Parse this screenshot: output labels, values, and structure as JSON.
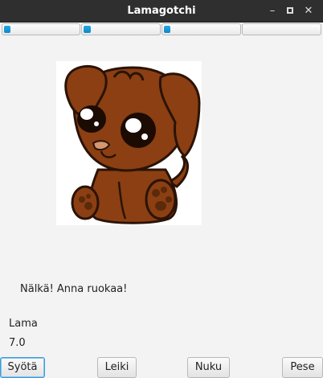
{
  "window": {
    "title": "Lamagotchi",
    "controls": {
      "minimize": "–",
      "maximize": "",
      "close": "✕"
    }
  },
  "status_bars": [
    {
      "name": "bar-1",
      "level": 0.09,
      "color": "#1798d6"
    },
    {
      "name": "bar-2",
      "level": 0.1,
      "color": "#1798d6"
    },
    {
      "name": "bar-3",
      "level": 0.09,
      "color": "#1798d6"
    },
    {
      "name": "bar-4",
      "level": 0.0,
      "color": "#1798d6"
    }
  ],
  "pet": {
    "image": "puppy-image"
  },
  "message": "Nälkä! Anna ruokaa!",
  "pet_name": "Lama",
  "pet_value": "7.0",
  "buttons": {
    "feed": "Syötä",
    "play": "Leiki",
    "sleep": "Nuku",
    "wash": "Pese"
  }
}
